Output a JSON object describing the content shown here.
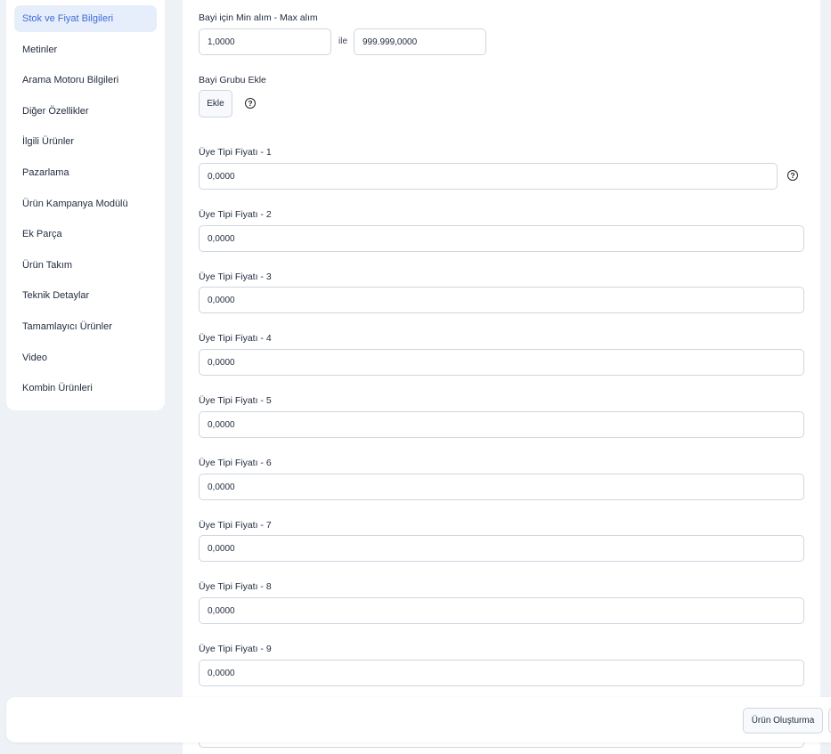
{
  "sidebar": {
    "items": [
      {
        "label": "Stok ve Fiyat Bilgileri",
        "active": true
      },
      {
        "label": "Metinler"
      },
      {
        "label": "Arama Motoru Bilgileri"
      },
      {
        "label": "Diğer Özellikler"
      },
      {
        "label": "İlgili Ürünler"
      },
      {
        "label": "Pazarlama"
      },
      {
        "label": "Ürün Kampanya Modülü"
      },
      {
        "label": "Ek Parça"
      },
      {
        "label": "Ürün Takım"
      },
      {
        "label": "Teknik Detaylar"
      },
      {
        "label": "Tamamlayıcı Ürünler"
      },
      {
        "label": "Video"
      },
      {
        "label": "Kombin Ürünleri"
      }
    ]
  },
  "main": {
    "dealer_minmax": {
      "label": "Bayi için Min alım - Max alım",
      "min_value": "1,0000",
      "separator": "ile",
      "max_value": "999.999,0000"
    },
    "dealer_group": {
      "label": "Bayi Grubu Ekle",
      "button": "Ekle",
      "help_icon": "question-circle-icon"
    },
    "member_prices": [
      {
        "label": "Üye Tipi Fiyatı - 1",
        "value": "0,0000"
      },
      {
        "label": "Üye Tipi Fiyatı - 2",
        "value": "0,0000"
      },
      {
        "label": "Üye Tipi Fiyatı - 3",
        "value": "0,0000"
      },
      {
        "label": "Üye Tipi Fiyatı - 4",
        "value": "0,0000"
      },
      {
        "label": "Üye Tipi Fiyatı - 5",
        "value": "0,0000"
      },
      {
        "label": "Üye Tipi Fiyatı - 6",
        "value": "0,0000"
      },
      {
        "label": "Üye Tipi Fiyatı - 7",
        "value": "0,0000"
      },
      {
        "label": "Üye Tipi Fiyatı - 8",
        "value": "0,0000"
      },
      {
        "label": "Üye Tipi Fiyatı - 9",
        "value": "0,0000"
      }
    ]
  },
  "footer": {
    "create_button": "Ürün Oluşturma"
  },
  "colors": {
    "accent": "#3f6ed8",
    "active_bg": "#e6edfb",
    "page_bg": "#eef1f6",
    "border": "#cfd6e0"
  }
}
